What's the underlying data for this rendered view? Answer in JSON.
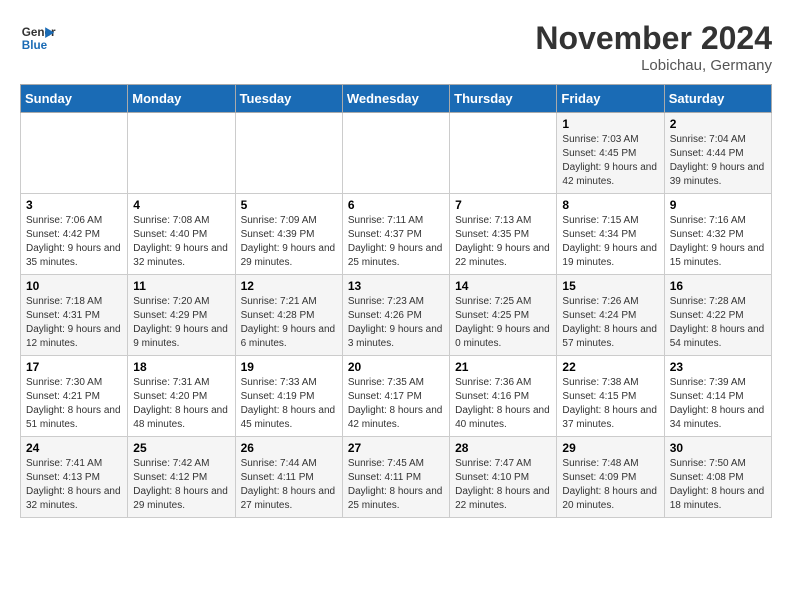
{
  "header": {
    "logo_line1": "General",
    "logo_line2": "Blue",
    "month": "November 2024",
    "location": "Lobichau, Germany"
  },
  "days_of_week": [
    "Sunday",
    "Monday",
    "Tuesday",
    "Wednesday",
    "Thursday",
    "Friday",
    "Saturday"
  ],
  "weeks": [
    [
      {
        "day": "",
        "info": ""
      },
      {
        "day": "",
        "info": ""
      },
      {
        "day": "",
        "info": ""
      },
      {
        "day": "",
        "info": ""
      },
      {
        "day": "",
        "info": ""
      },
      {
        "day": "1",
        "info": "Sunrise: 7:03 AM\nSunset: 4:45 PM\nDaylight: 9 hours and 42 minutes."
      },
      {
        "day": "2",
        "info": "Sunrise: 7:04 AM\nSunset: 4:44 PM\nDaylight: 9 hours and 39 minutes."
      }
    ],
    [
      {
        "day": "3",
        "info": "Sunrise: 7:06 AM\nSunset: 4:42 PM\nDaylight: 9 hours and 35 minutes."
      },
      {
        "day": "4",
        "info": "Sunrise: 7:08 AM\nSunset: 4:40 PM\nDaylight: 9 hours and 32 minutes."
      },
      {
        "day": "5",
        "info": "Sunrise: 7:09 AM\nSunset: 4:39 PM\nDaylight: 9 hours and 29 minutes."
      },
      {
        "day": "6",
        "info": "Sunrise: 7:11 AM\nSunset: 4:37 PM\nDaylight: 9 hours and 25 minutes."
      },
      {
        "day": "7",
        "info": "Sunrise: 7:13 AM\nSunset: 4:35 PM\nDaylight: 9 hours and 22 minutes."
      },
      {
        "day": "8",
        "info": "Sunrise: 7:15 AM\nSunset: 4:34 PM\nDaylight: 9 hours and 19 minutes."
      },
      {
        "day": "9",
        "info": "Sunrise: 7:16 AM\nSunset: 4:32 PM\nDaylight: 9 hours and 15 minutes."
      }
    ],
    [
      {
        "day": "10",
        "info": "Sunrise: 7:18 AM\nSunset: 4:31 PM\nDaylight: 9 hours and 12 minutes."
      },
      {
        "day": "11",
        "info": "Sunrise: 7:20 AM\nSunset: 4:29 PM\nDaylight: 9 hours and 9 minutes."
      },
      {
        "day": "12",
        "info": "Sunrise: 7:21 AM\nSunset: 4:28 PM\nDaylight: 9 hours and 6 minutes."
      },
      {
        "day": "13",
        "info": "Sunrise: 7:23 AM\nSunset: 4:26 PM\nDaylight: 9 hours and 3 minutes."
      },
      {
        "day": "14",
        "info": "Sunrise: 7:25 AM\nSunset: 4:25 PM\nDaylight: 9 hours and 0 minutes."
      },
      {
        "day": "15",
        "info": "Sunrise: 7:26 AM\nSunset: 4:24 PM\nDaylight: 8 hours and 57 minutes."
      },
      {
        "day": "16",
        "info": "Sunrise: 7:28 AM\nSunset: 4:22 PM\nDaylight: 8 hours and 54 minutes."
      }
    ],
    [
      {
        "day": "17",
        "info": "Sunrise: 7:30 AM\nSunset: 4:21 PM\nDaylight: 8 hours and 51 minutes."
      },
      {
        "day": "18",
        "info": "Sunrise: 7:31 AM\nSunset: 4:20 PM\nDaylight: 8 hours and 48 minutes."
      },
      {
        "day": "19",
        "info": "Sunrise: 7:33 AM\nSunset: 4:19 PM\nDaylight: 8 hours and 45 minutes."
      },
      {
        "day": "20",
        "info": "Sunrise: 7:35 AM\nSunset: 4:17 PM\nDaylight: 8 hours and 42 minutes."
      },
      {
        "day": "21",
        "info": "Sunrise: 7:36 AM\nSunset: 4:16 PM\nDaylight: 8 hours and 40 minutes."
      },
      {
        "day": "22",
        "info": "Sunrise: 7:38 AM\nSunset: 4:15 PM\nDaylight: 8 hours and 37 minutes."
      },
      {
        "day": "23",
        "info": "Sunrise: 7:39 AM\nSunset: 4:14 PM\nDaylight: 8 hours and 34 minutes."
      }
    ],
    [
      {
        "day": "24",
        "info": "Sunrise: 7:41 AM\nSunset: 4:13 PM\nDaylight: 8 hours and 32 minutes."
      },
      {
        "day": "25",
        "info": "Sunrise: 7:42 AM\nSunset: 4:12 PM\nDaylight: 8 hours and 29 minutes."
      },
      {
        "day": "26",
        "info": "Sunrise: 7:44 AM\nSunset: 4:11 PM\nDaylight: 8 hours and 27 minutes."
      },
      {
        "day": "27",
        "info": "Sunrise: 7:45 AM\nSunset: 4:11 PM\nDaylight: 8 hours and 25 minutes."
      },
      {
        "day": "28",
        "info": "Sunrise: 7:47 AM\nSunset: 4:10 PM\nDaylight: 8 hours and 22 minutes."
      },
      {
        "day": "29",
        "info": "Sunrise: 7:48 AM\nSunset: 4:09 PM\nDaylight: 8 hours and 20 minutes."
      },
      {
        "day": "30",
        "info": "Sunrise: 7:50 AM\nSunset: 4:08 PM\nDaylight: 8 hours and 18 minutes."
      }
    ]
  ]
}
